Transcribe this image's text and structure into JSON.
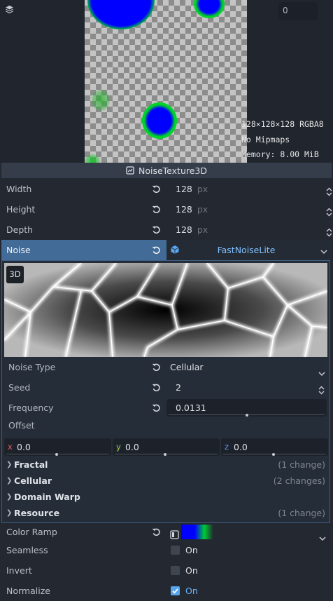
{
  "layer_spinner": {
    "value": "0"
  },
  "texture_info": {
    "dimensions": "128×128×128 RGBA8",
    "mipmaps": "No Mipmaps",
    "memory": "Memory: 8.00 MiB"
  },
  "resource_header": {
    "title": "NoiseTexture3D"
  },
  "properties": {
    "width": {
      "label": "Width",
      "value": "128",
      "unit": "px"
    },
    "height": {
      "label": "Height",
      "value": "128",
      "unit": "px"
    },
    "depth": {
      "label": "Depth",
      "value": "128",
      "unit": "px"
    }
  },
  "noise": {
    "label": "Noise",
    "resource": "FastNoiseLite"
  },
  "noise_preview": {
    "badge": "3D"
  },
  "noise_settings": {
    "noise_type": {
      "label": "Noise Type",
      "value": "Cellular"
    },
    "seed": {
      "label": "Seed",
      "value": "2"
    },
    "frequency": {
      "label": "Frequency",
      "value": "0.0131",
      "slider_fraction": 0.5
    },
    "offset": {
      "label": "Offset",
      "x": {
        "axis": "x",
        "value": "0.0",
        "color": "#e05858"
      },
      "y": {
        "axis": "y",
        "value": "0.0",
        "color": "#98cf58"
      },
      "z": {
        "axis": "z",
        "value": "0.0",
        "color": "#5d8ff0"
      }
    }
  },
  "sections": [
    {
      "name": "Fractal",
      "changes": "(1 change)"
    },
    {
      "name": "Cellular",
      "changes": "(2 changes)"
    },
    {
      "name": "Domain Warp",
      "changes": ""
    },
    {
      "name": "Resource",
      "changes": "(1 change)"
    }
  ],
  "color_ramp": {
    "label": "Color Ramp",
    "stops": [
      "#0000ff",
      "#00cc33",
      "#00000000"
    ]
  },
  "toggles": {
    "seamless": {
      "label": "Seamless",
      "value": "On",
      "checked": false
    },
    "invert": {
      "label": "Invert",
      "value": "On",
      "checked": false
    },
    "normalize": {
      "label": "Normalize",
      "value": "On",
      "checked": true
    }
  },
  "colors": {
    "accent": "#57a5ec",
    "selected_row": "#426b98",
    "panel_bg": "#232831"
  }
}
